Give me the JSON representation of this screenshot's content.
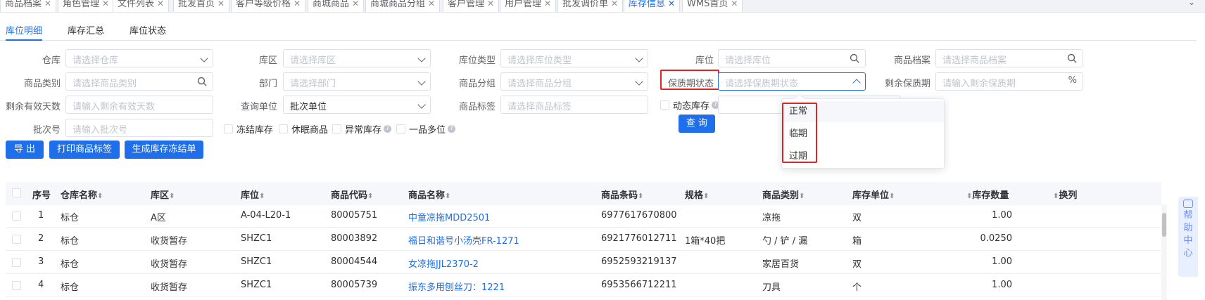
{
  "tabs": [
    {
      "label": "商品档案",
      "active": false
    },
    {
      "label": "角色管理",
      "active": false
    },
    {
      "label": "文件列表",
      "active": false
    },
    {
      "label": "批发首页",
      "active": false
    },
    {
      "label": "客户等级价格",
      "active": false
    },
    {
      "label": "商城商品",
      "active": false
    },
    {
      "label": "商城商品分组",
      "active": false
    },
    {
      "label": "客户管理",
      "active": false
    },
    {
      "label": "用户管理",
      "active": false
    },
    {
      "label": "批发调价单",
      "active": false
    },
    {
      "label": "库存信息",
      "active": true
    },
    {
      "label": "WMS首页",
      "active": false
    }
  ],
  "tab_close_glyph": "✕",
  "subtabs": [
    "库位明细",
    "库存汇总",
    "库位状态"
  ],
  "form": {
    "warehouse": {
      "label": "仓库",
      "placeholder": "请选择仓库"
    },
    "zone": {
      "label": "库区",
      "placeholder": "请选择库区"
    },
    "location_type": {
      "label": "库位类型",
      "placeholder": "请选择库位类型"
    },
    "location": {
      "label": "库位",
      "placeholder": "请选择库位"
    },
    "product_archive": {
      "label": "商品档案",
      "placeholder": "请选择商品档案"
    },
    "category": {
      "label": "商品类别",
      "placeholder": "请选择商品类别"
    },
    "department": {
      "label": "部门",
      "placeholder": "请选择部门"
    },
    "product_group": {
      "label": "商品分组",
      "placeholder": "请选择商品分组"
    },
    "shelf_status": {
      "label": "保质期状态",
      "placeholder": "请选择保质期状态"
    },
    "remaining_shelf": {
      "label": "剩余保质期",
      "placeholder": "请输入剩余保质期",
      "suffix": "%"
    },
    "remaining_days": {
      "label": "剩余有效天数",
      "placeholder": "请输入剩余有效天数"
    },
    "query_unit": {
      "label": "查询单位",
      "value": "批次单位"
    },
    "product_tag": {
      "label": "商品标签",
      "placeholder": "请选择商品标签"
    },
    "dynamic_stock": {
      "label": "动态库存"
    },
    "batch_no": {
      "label": "批次号",
      "placeholder": "请输入批次号"
    },
    "checkboxes": [
      "冻结库存",
      "休眠商品",
      "异常库存",
      "一品多位"
    ],
    "query_button": "查 询"
  },
  "shelf_status_options": [
    "正常",
    "临期",
    "过期"
  ],
  "actions": [
    "导 出",
    "打印商品标签",
    "生成库存冻结单"
  ],
  "table": {
    "columns": [
      "序号",
      "仓库名称",
      "库区",
      "库位",
      "商品代码",
      "商品名称",
      "商品条码",
      "规格",
      "商品类别",
      "库存单位",
      "库存数量",
      "换列"
    ],
    "sort_glyph": "⬍",
    "rows": [
      [
        "1",
        "标仓",
        "A区",
        "A-04-L20-1",
        "80005751",
        "中童凉拖MDD2501",
        "6977617670800",
        "",
        "凉拖",
        "双",
        "1.00"
      ],
      [
        "2",
        "标仓",
        "收货暂存",
        "SHZC1",
        "80003892",
        "福日和谐号小汤壳FR-1271",
        "6921776012711",
        "1箱*40把",
        "勺 / 铲 / 漏",
        "箱",
        "0.0250"
      ],
      [
        "3",
        "标仓",
        "收货暂存",
        "SHZC1",
        "80004544",
        "女凉拖JJL2370-2",
        "6952593219137",
        "",
        "家居百货",
        "双",
        "1.00"
      ],
      [
        "4",
        "标仓",
        "收货暂存",
        "SHZC1",
        "80005739",
        "振东多用刨丝刀：1221",
        "6953566712211",
        "",
        "刀具",
        "个",
        "1.00"
      ]
    ]
  },
  "helper_text": [
    "帮",
    "助",
    "中",
    "心"
  ],
  "colors": {
    "primary": "#1f6feb",
    "highlight": "#e02424"
  }
}
